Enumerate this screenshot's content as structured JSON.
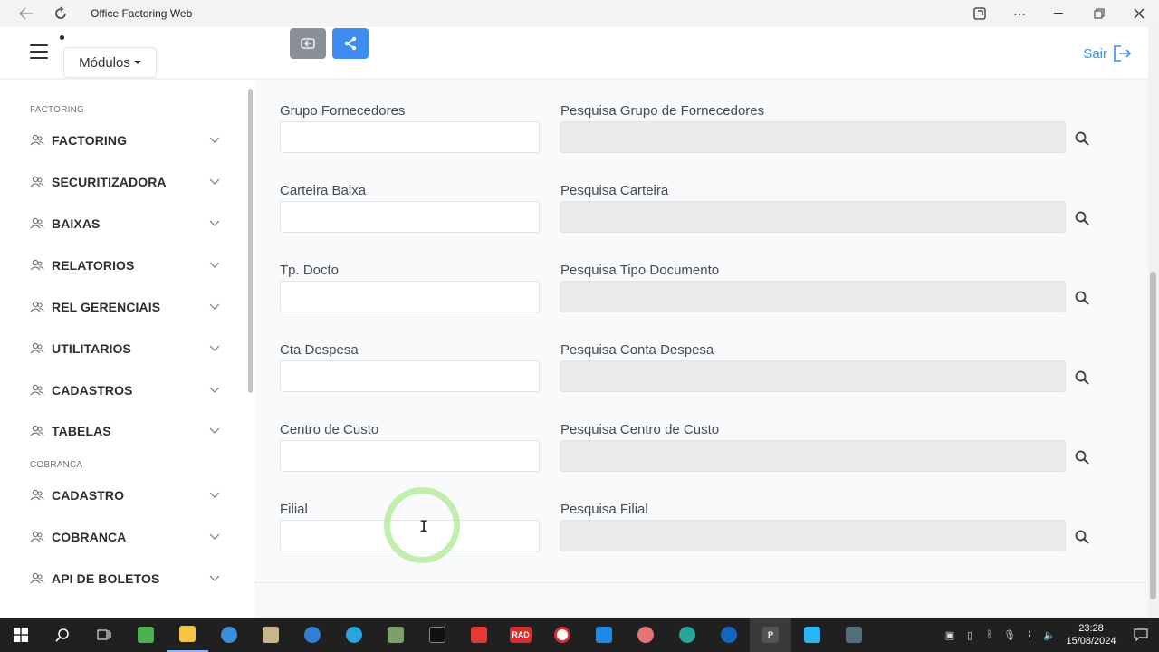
{
  "window": {
    "title": "Office Factoring Web"
  },
  "header": {
    "modulos_label": "Módulos",
    "sair_label": "Sair"
  },
  "sidebar": {
    "section_factoring": "FACTORING",
    "section_cobranca": "COBRANCA",
    "items": [
      {
        "label": "FACTORING"
      },
      {
        "label": "SECURITIZADORA"
      },
      {
        "label": "BAIXAS"
      },
      {
        "label": "RELATORIOS"
      },
      {
        "label": "REL GERENCIAIS"
      },
      {
        "label": "UTILITARIOS"
      },
      {
        "label": "CADASTROS"
      },
      {
        "label": "TABELAS"
      },
      {
        "label": "CADASTRO"
      },
      {
        "label": "COBRANCA"
      },
      {
        "label": "API DE BOLETOS"
      }
    ]
  },
  "form": {
    "rows": [
      {
        "label": "Grupo Fornecedores",
        "value": "",
        "search_label": "Pesquisa Grupo de Fornecedores",
        "search_value": ""
      },
      {
        "label": "Carteira Baixa",
        "value": "",
        "search_label": "Pesquisa Carteira",
        "search_value": ""
      },
      {
        "label": "Tp. Docto",
        "value": "",
        "search_label": "Pesquisa Tipo Documento",
        "search_value": ""
      },
      {
        "label": "Cta Despesa",
        "value": "",
        "search_label": "Pesquisa Conta Despesa",
        "search_value": ""
      },
      {
        "label": "Centro de Custo",
        "value": "",
        "search_label": "Pesquisa Centro de Custo",
        "search_value": ""
      },
      {
        "label": "Filial",
        "value": "",
        "search_label": "Pesquisa Filial",
        "search_value": ""
      }
    ]
  },
  "taskbar": {
    "rad_label": "RAD",
    "p_label": "P",
    "time": "23:28",
    "date": "15/08/2024"
  },
  "colors": {
    "accent": "#3d8ef0",
    "back_button": "#8a9099"
  }
}
